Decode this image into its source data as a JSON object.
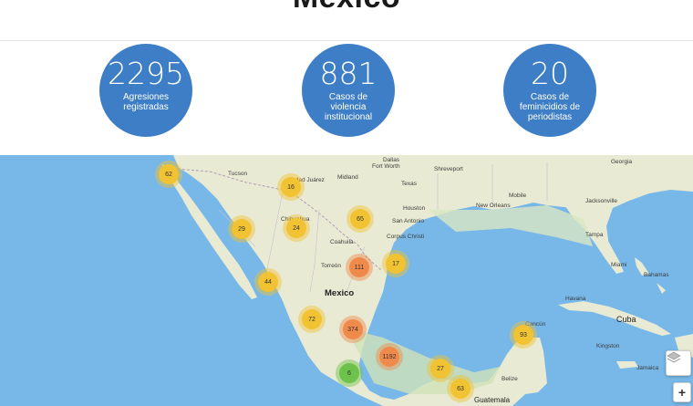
{
  "header": {
    "title": "Mexico"
  },
  "stats": [
    {
      "number": "2295",
      "label": "Agresiones registradas"
    },
    {
      "number": "881",
      "label": "Casos de violencia institucional"
    },
    {
      "number": "20",
      "label": "Casos de feminicidios de periodistas"
    }
  ],
  "map": {
    "places": [
      "Tucson",
      "Ciudad Juárez",
      "Midland",
      "Fort Worth",
      "Shreveport",
      "Houston",
      "San Antonio",
      "New Orleans",
      "Mobile",
      "Jacksonville",
      "Tampa",
      "Miami",
      "Bahamas",
      "Havana",
      "Cuba",
      "Torreón",
      "Mexico",
      "Cancún",
      "Belize",
      "Guatemala",
      "Jamaica",
      "Corpus Christi",
      "Kingston",
      "Chihuahua",
      "Coahuila",
      "Texas",
      "Georgia",
      "Dallas"
    ],
    "country_label": "Mexico",
    "clusters": [
      {
        "count": "62",
        "color": "yellow"
      },
      {
        "count": "16",
        "color": "yellow"
      },
      {
        "count": "29",
        "color": "yellow"
      },
      {
        "count": "24",
        "color": "yellow"
      },
      {
        "count": "65",
        "color": "yellow"
      },
      {
        "count": "111",
        "color": "orange"
      },
      {
        "count": "17",
        "color": "yellow"
      },
      {
        "count": "44",
        "color": "yellow"
      },
      {
        "count": "72",
        "color": "yellow"
      },
      {
        "count": "374",
        "color": "orange"
      },
      {
        "count": "1192",
        "color": "orange"
      },
      {
        "count": "6",
        "color": "green"
      },
      {
        "count": "27",
        "color": "yellow"
      },
      {
        "count": "63",
        "color": "yellow"
      },
      {
        "count": "93",
        "color": "yellow"
      }
    ],
    "controls": {
      "layers_icon": "layers-icon",
      "zoom_in_label": "+"
    },
    "colors": {
      "water": "#77b8e8",
      "land": "#e9ead3",
      "cluster_yellow": "#f1c232",
      "cluster_orange": "#f08a4b",
      "cluster_green": "#6cc24a",
      "stat_circle": "#3d7ec6"
    }
  }
}
